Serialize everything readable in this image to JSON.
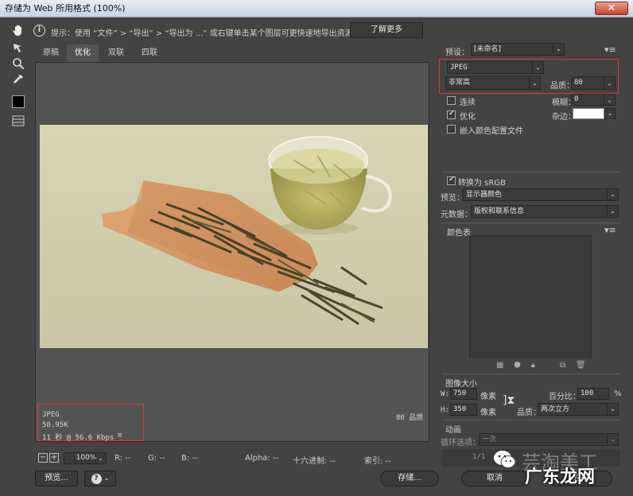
{
  "window": {
    "title": "存储为 Web 所用格式 (100%)",
    "close_glyph": "✕"
  },
  "hint": {
    "icon": "info-icon",
    "text": "提示：使用 “文件” > “导出” > “导出为 ...” 或右键单击某个图层可更快速地导出资源",
    "learn_more": "了解更多"
  },
  "tabs": [
    "原稿",
    "优化",
    "双联",
    "四联"
  ],
  "active_tab": "优化",
  "preview_info": {
    "format": "JPEG",
    "size": "58.95K",
    "time": "11 秒 @ 56.6 Kbps",
    "menu_glyph": "≡",
    "quality": "80 品质"
  },
  "status": {
    "zoom": "100%",
    "r": "R: --",
    "g": "G: --",
    "b": "B: --",
    "alpha": "Alpha: --",
    "hex": "十六进制: --",
    "index": "索引: --",
    "minus": "−",
    "plus": "+"
  },
  "buttons": {
    "preview": "预览...",
    "help_glyph": "?",
    "save": "存储...",
    "cancel": "取消",
    "done": "完成"
  },
  "settings": {
    "preset_label": "预设：",
    "preset_value": "[未命名]",
    "format": "JPEG",
    "quality_level": "非常高",
    "quality_label": "品质：",
    "quality_value": "80",
    "progressive": "连续",
    "blur_label": "模糊：",
    "blur_value": "0",
    "optimized": "优化",
    "matte_label": "杂边：",
    "embed_profile": "嵌入颜色配置文件",
    "convert_srgb": "转换为 sRGB",
    "preview_label": "预览：",
    "preview_value": "显示器颜色",
    "metadata_label": "元数据：",
    "metadata_value": "版权和联系信息",
    "color_table": "颜色表"
  },
  "image_size": {
    "title": "图像大小",
    "w_label": "W:",
    "w_value": "750",
    "h_label": "H:",
    "h_value": "350",
    "unit": "像素",
    "percent_label": "百分比：",
    "percent_value": "100",
    "percent_unit": "%",
    "quality_label": "品质：",
    "quality_value": "两次立方"
  },
  "animation": {
    "title": "动画",
    "loop_label": "循环选项：",
    "loop_value": "一次",
    "frame": "1/1"
  },
  "watermark": {
    "text": "广东龙网",
    "faint_text": "芸淘美工"
  },
  "colors": {
    "accent_red": "#d93a3a",
    "panel_bg": "#434343",
    "field_bg": "#3a3a3a"
  }
}
